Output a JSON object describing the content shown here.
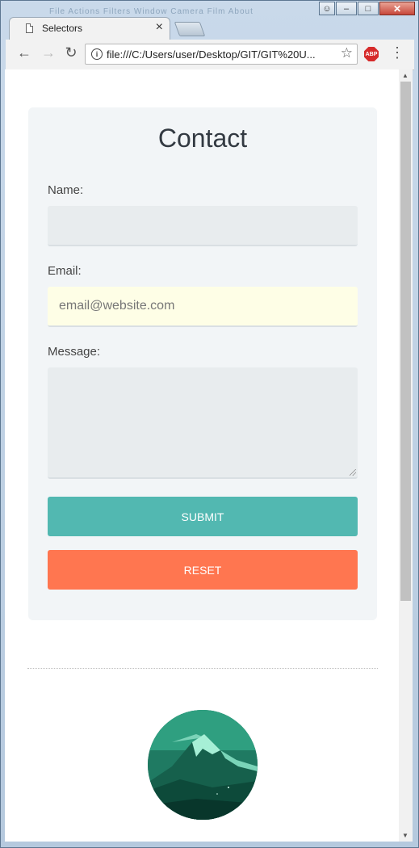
{
  "window": {
    "faded_title": "File   Actions   Filters   Window   Camera   Film   About",
    "controls": {
      "minimize": "–",
      "maximize": "□",
      "close": "✕",
      "user": "☺"
    }
  },
  "tab": {
    "title": "Selectors",
    "close": "×"
  },
  "toolbar": {
    "back": "←",
    "forward": "→",
    "reload": "↻",
    "url": "file:///C:/Users/user/Desktop/GIT/GIT%20U...",
    "info": "i",
    "bookmark": "☆",
    "extension": "ABP",
    "menu": "⋮"
  },
  "scrollbar": {
    "up": "▲",
    "down": "▼"
  },
  "form": {
    "title": "Contact",
    "name_label": "Name:",
    "name_value": "",
    "email_label": "Email:",
    "email_placeholder": "email@website.com",
    "message_label": "Message:",
    "message_value": "",
    "submit_label": "SUBMIT",
    "reset_label": "RESET"
  },
  "colors": {
    "submit": "#52b8b1",
    "reset": "#ff7650",
    "card": "#f2f5f7",
    "email_autofill": "#fefee6"
  },
  "avatar": {
    "icon": "mountain-landscape-image"
  }
}
